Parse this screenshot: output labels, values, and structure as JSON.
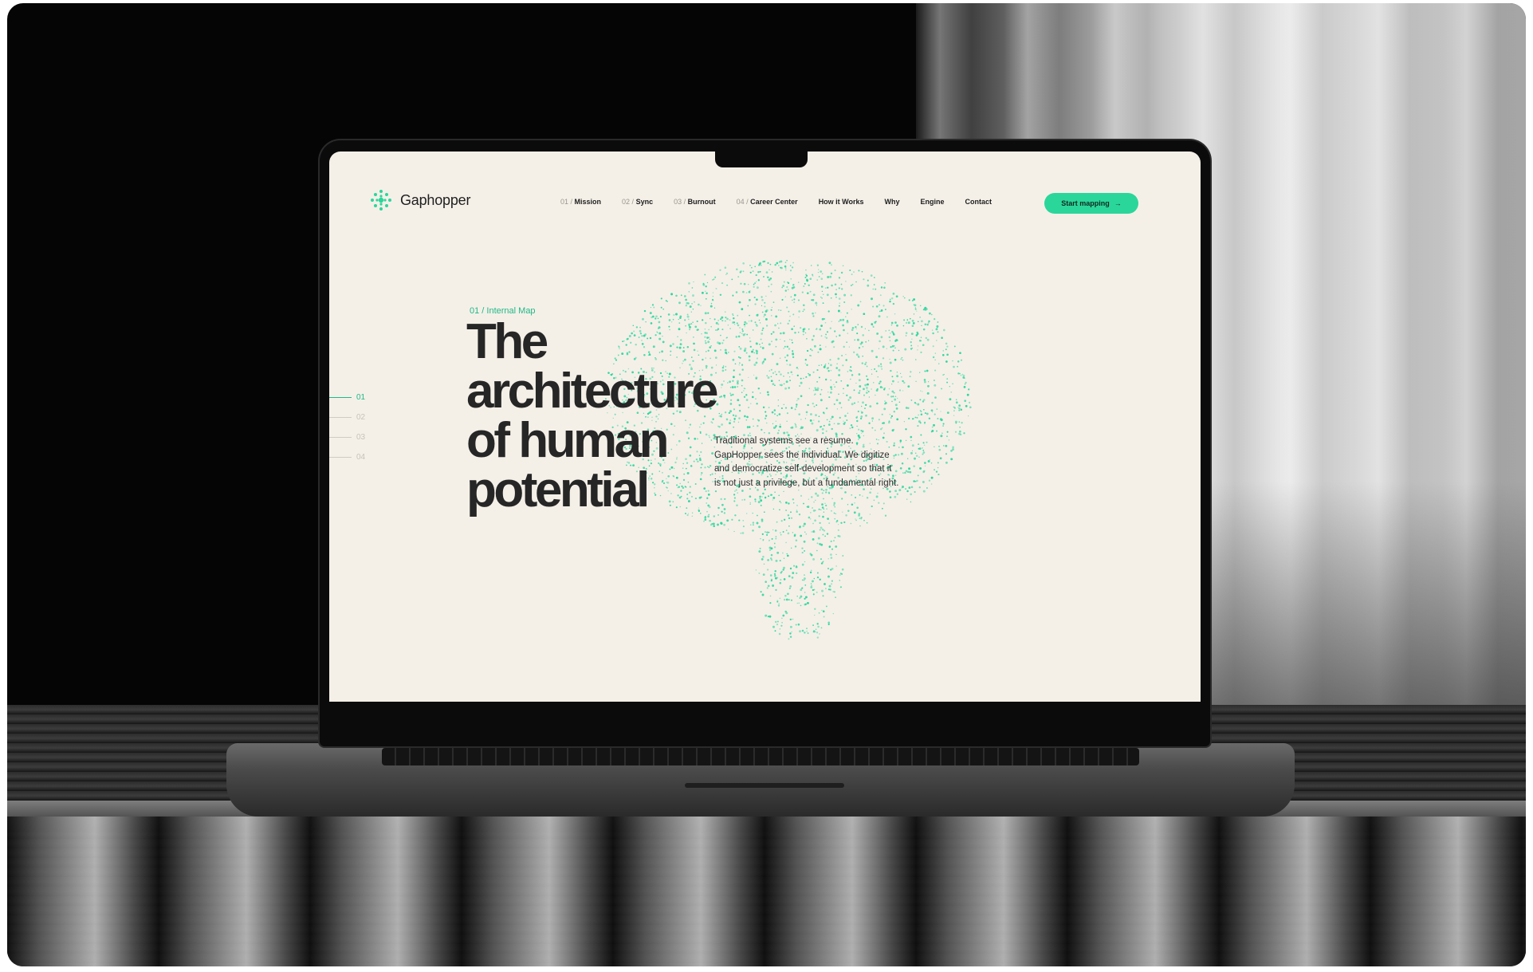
{
  "brand": {
    "name": "Gaphopper",
    "accent": "#2bd69b"
  },
  "nav": {
    "items": [
      {
        "num": "01 /",
        "label": "Mission"
      },
      {
        "num": "02 /",
        "label": "Sync"
      },
      {
        "num": "03 /",
        "label": "Burnout"
      },
      {
        "num": "04 /",
        "label": "Career Center"
      },
      {
        "num": "",
        "label": "How it Works"
      },
      {
        "num": "",
        "label": "Why"
      },
      {
        "num": "",
        "label": "Engine"
      },
      {
        "num": "",
        "label": "Contact"
      }
    ],
    "cta": {
      "label": "Start mapping",
      "icon": "arrow-right-icon",
      "arrow": "→"
    }
  },
  "hero": {
    "eyebrow": "01 / Internal Map",
    "headline": [
      "The",
      "architecture",
      "of human",
      "potential"
    ],
    "description": "Traditional systems see a resume. GapHopper sees the individual. We digitize and democratize self-development so that it is not just a privilege, but a fundamental right.",
    "visual": "brain-particle-cloud"
  },
  "side_nav": {
    "items": [
      "01",
      "02",
      "03",
      "04"
    ],
    "active_index": 0
  }
}
